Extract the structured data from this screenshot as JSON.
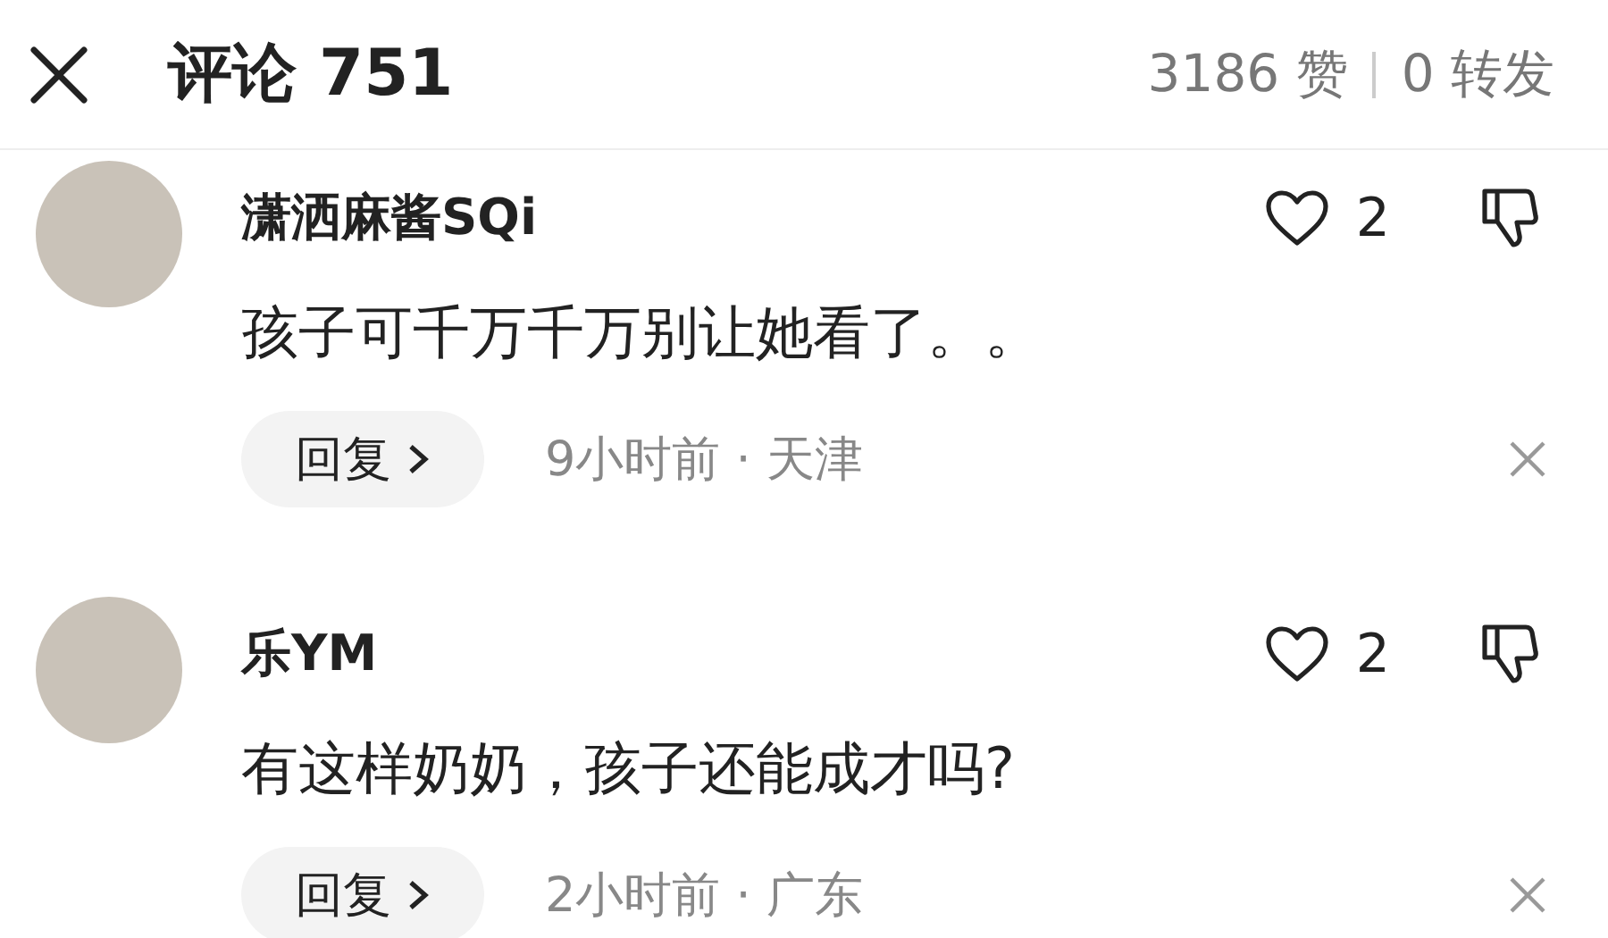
{
  "header": {
    "title": "评论 751",
    "likes": "3186 赞",
    "shares": "0 转发"
  },
  "comments": [
    {
      "name": "潇洒麻酱SQi",
      "text": "孩子可千万千万别让她看了。。",
      "likes": "2",
      "reply": "回复",
      "time": "9小时前 · 天津"
    },
    {
      "name": "乐YM",
      "text": "有这样奶奶，孩子还能成才吗?",
      "likes": "2",
      "reply": "回复",
      "time": "2小时前 · 广东"
    }
  ]
}
